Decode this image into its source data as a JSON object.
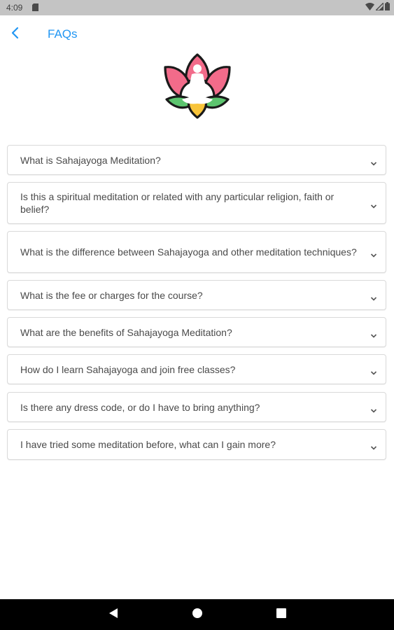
{
  "status_bar": {
    "time": "4:09"
  },
  "header": {
    "title": "FAQs",
    "back_icon": "chevron-left-icon"
  },
  "colors": {
    "accent": "#2196f3",
    "status_bar_bg": "#c4c4c4",
    "nav_bar_bg": "#000000",
    "card_border": "#d9d9d9",
    "text": "#4a4a4a"
  },
  "faqs": [
    {
      "question": "What is Sahajayoga Meditation?"
    },
    {
      "question": "Is this a spiritual meditation or related with any particular religion, faith or belief?"
    },
    {
      "question": "What is the difference between Sahajayoga and other meditation techniques?"
    },
    {
      "question": " What is the fee or charges for the course?"
    },
    {
      "question": "What are the benefits of Sahajayoga Meditation?"
    },
    {
      "question": "How do I learn Sahajayoga and join free classes?"
    },
    {
      "question": "Is there any dress code, or do I have to bring anything?"
    },
    {
      "question": "I have tried some meditation before, what can I gain more?"
    }
  ]
}
